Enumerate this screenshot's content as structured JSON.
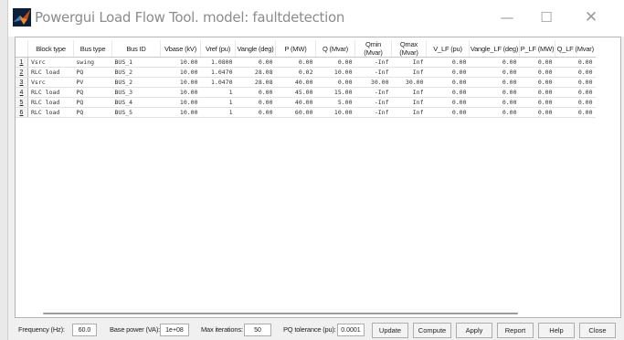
{
  "window": {
    "title": "Powergui Load Flow Tool. model: faultdetection",
    "controls": {
      "minimize": "—",
      "maximize": "☐",
      "close": "✕"
    }
  },
  "table": {
    "headers": [
      "Block type",
      "Bus type",
      "Bus ID",
      "Vbase (kV)",
      "Vref (pu)",
      "Vangle (deg)",
      "P (MW)",
      "Q (Mvar)",
      "Qmin (Mvar)",
      "Qmax (Mvar)",
      "V_LF (pu)",
      "Vangle_LF (deg)",
      "P_LF (MW)",
      "Q_LF (Mvar)"
    ],
    "rows": [
      {
        "index": "1",
        "cells": [
          "Vsrc",
          "swing",
          "BUS_1",
          "10.00",
          "1.0800",
          "0.00",
          "0.00",
          "0.00",
          "-Inf",
          "Inf",
          "0.00",
          "0.00",
          "0.00",
          "0.00"
        ]
      },
      {
        "index": "2",
        "cells": [
          "RLC load",
          "PQ",
          "BUS_2",
          "10.00",
          "1.0470",
          "28.08",
          "0.02",
          "10.00",
          "-Inf",
          "Inf",
          "0.00",
          "0.00",
          "0.00",
          "0.00"
        ]
      },
      {
        "index": "3",
        "cells": [
          "Vsrc",
          "PV",
          "BUS_2",
          "10.00",
          "1.0470",
          "28.08",
          "40.00",
          "0.00",
          "30.00",
          "30.00",
          "0.00",
          "0.00",
          "0.00",
          "0.00"
        ]
      },
      {
        "index": "4",
        "cells": [
          "RLC load",
          "PQ",
          "BUS_3",
          "10.00",
          "1",
          "0.00",
          "45.00",
          "15.00",
          "-Inf",
          "Inf",
          "0.00",
          "0.00",
          "0.00",
          "0.00"
        ]
      },
      {
        "index": "5",
        "cells": [
          "RLC load",
          "PQ",
          "BUS_4",
          "10.00",
          "1",
          "0.00",
          "40.00",
          "5.00",
          "-Inf",
          "Inf",
          "0.00",
          "0.00",
          "0.00",
          "0.00"
        ]
      },
      {
        "index": "6",
        "cells": [
          "RLC load",
          "PQ",
          "BUS_5",
          "10.00",
          "1",
          "0.00",
          "60.00",
          "10.00",
          "-Inf",
          "Inf",
          "0.00",
          "0.00",
          "0.00",
          "0.00"
        ]
      }
    ]
  },
  "bottom": {
    "frequency_label": "Frequency (Hz):",
    "frequency_value": "60.0",
    "base_power_label": "Base power (VA):",
    "base_power_value": "1e+08",
    "max_iter_label": "Max iterations:",
    "max_iter_value": "50",
    "pq_tol_label": "PQ tolerance (pu):",
    "pq_tol_value": "0.0001",
    "buttons": {
      "update": "Update",
      "compute": "Compute",
      "apply": "Apply",
      "report": "Report",
      "help": "Help",
      "close": "Close"
    }
  }
}
